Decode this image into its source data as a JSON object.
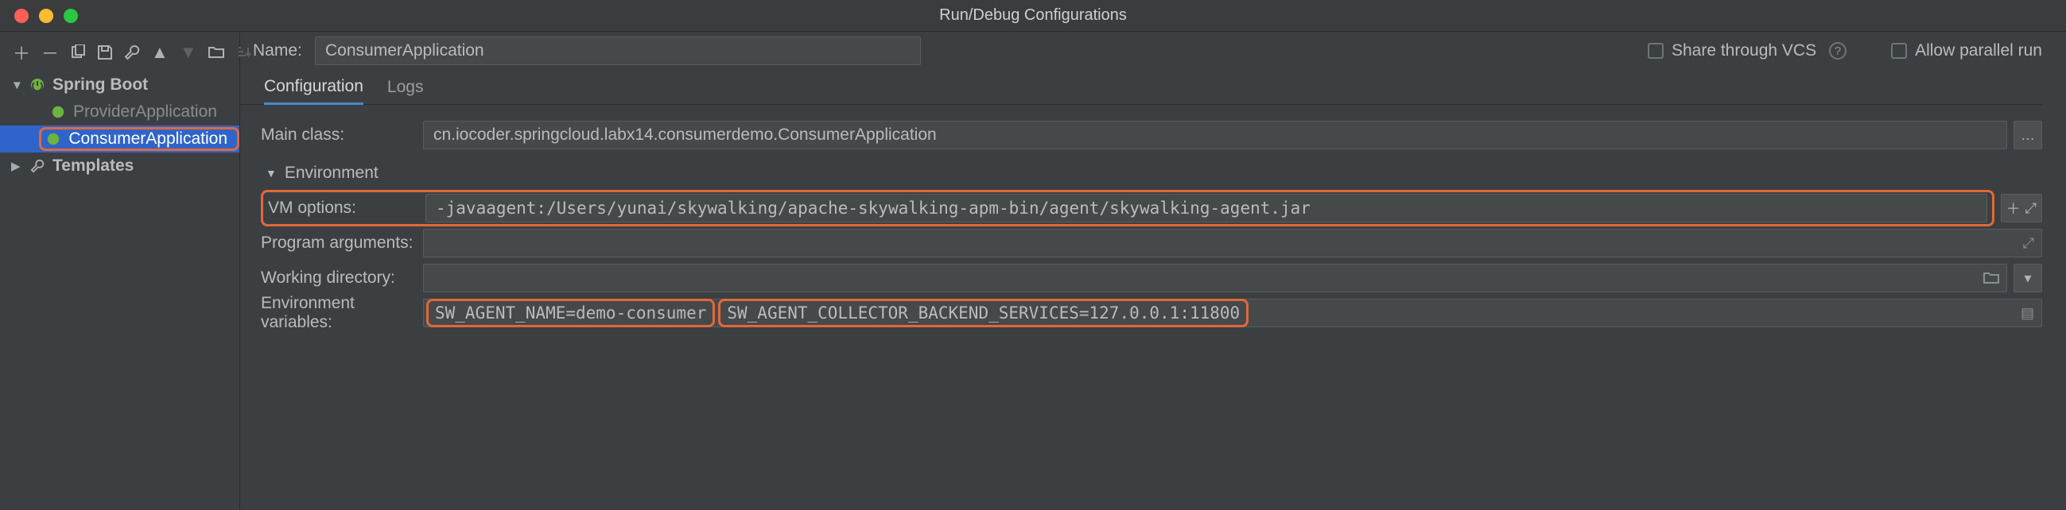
{
  "window": {
    "title": "Run/Debug Configurations"
  },
  "sidebar": {
    "root": {
      "label": "Spring Boot"
    },
    "items": [
      {
        "label": "ProviderApplication"
      },
      {
        "label": "ConsumerApplication"
      }
    ],
    "templates": {
      "label": "Templates"
    }
  },
  "header": {
    "name_label": "Name:",
    "name_value": "ConsumerApplication",
    "share_label": "Share through VCS",
    "parallel_label": "Allow parallel run"
  },
  "tabs": {
    "config": "Configuration",
    "logs": "Logs"
  },
  "form": {
    "main_class_label": "Main class:",
    "main_class_value": "cn.iocoder.springcloud.labx14.consumerdemo.ConsumerApplication",
    "env_section": "Environment",
    "vm_label": "VM options:",
    "vm_value": "-javaagent:/Users/yunai/skywalking/apache-skywalking-apm-bin/agent/skywalking-agent.jar",
    "args_label": "Program arguments:",
    "args_value": "",
    "wd_label": "Working directory:",
    "wd_value": "",
    "envvar_label": "Environment variables:",
    "envvar_a": "SW_AGENT_NAME=demo-consumer",
    "envvar_b": "SW_AGENT_COLLECTOR_BACKEND_SERVICES=127.0.0.1:11800"
  },
  "icons": {
    "ellipsis": "…",
    "plus": "＋",
    "expand": "⤢",
    "folder": "📁",
    "dropdown": "▾",
    "list": "▤"
  }
}
